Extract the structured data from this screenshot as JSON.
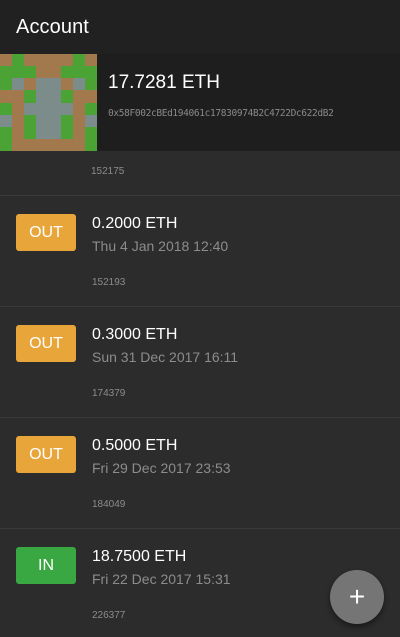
{
  "appbar": {
    "title": "Account"
  },
  "account": {
    "balance": "17.7281 ETH",
    "address": "0x58F002cBEd194061c17830974B2C4722Dc622dB2",
    "identicon_colors": {
      "green": "#4aa334",
      "tan": "#a2794d",
      "gray": "#7b8c8a"
    },
    "identicon_pattern": [
      "TGTTTTGT",
      "GGGTTGGG",
      "GYTYYTYG",
      "TTGYYGTT",
      "GTYYYYTG",
      "YTGYYGTY",
      "GTGYYGTG",
      "GTTTTTTG"
    ]
  },
  "first_block": "152175",
  "transactions": [
    {
      "direction": "OUT",
      "amount": "0.2000 ETH",
      "date": "Thu 4 Jan 2018 12:40",
      "block": "152193"
    },
    {
      "direction": "OUT",
      "amount": "0.3000 ETH",
      "date": "Sun 31 Dec 2017 16:11",
      "block": "174379"
    },
    {
      "direction": "OUT",
      "amount": "0.5000 ETH",
      "date": "Fri 29 Dec 2017 23:53",
      "block": "184049"
    },
    {
      "direction": "IN",
      "amount": "18.7500 ETH",
      "date": "Fri 22 Dec 2017 15:31",
      "block": "226377"
    }
  ],
  "fab": {
    "icon": "plus-icon",
    "label": "+"
  }
}
